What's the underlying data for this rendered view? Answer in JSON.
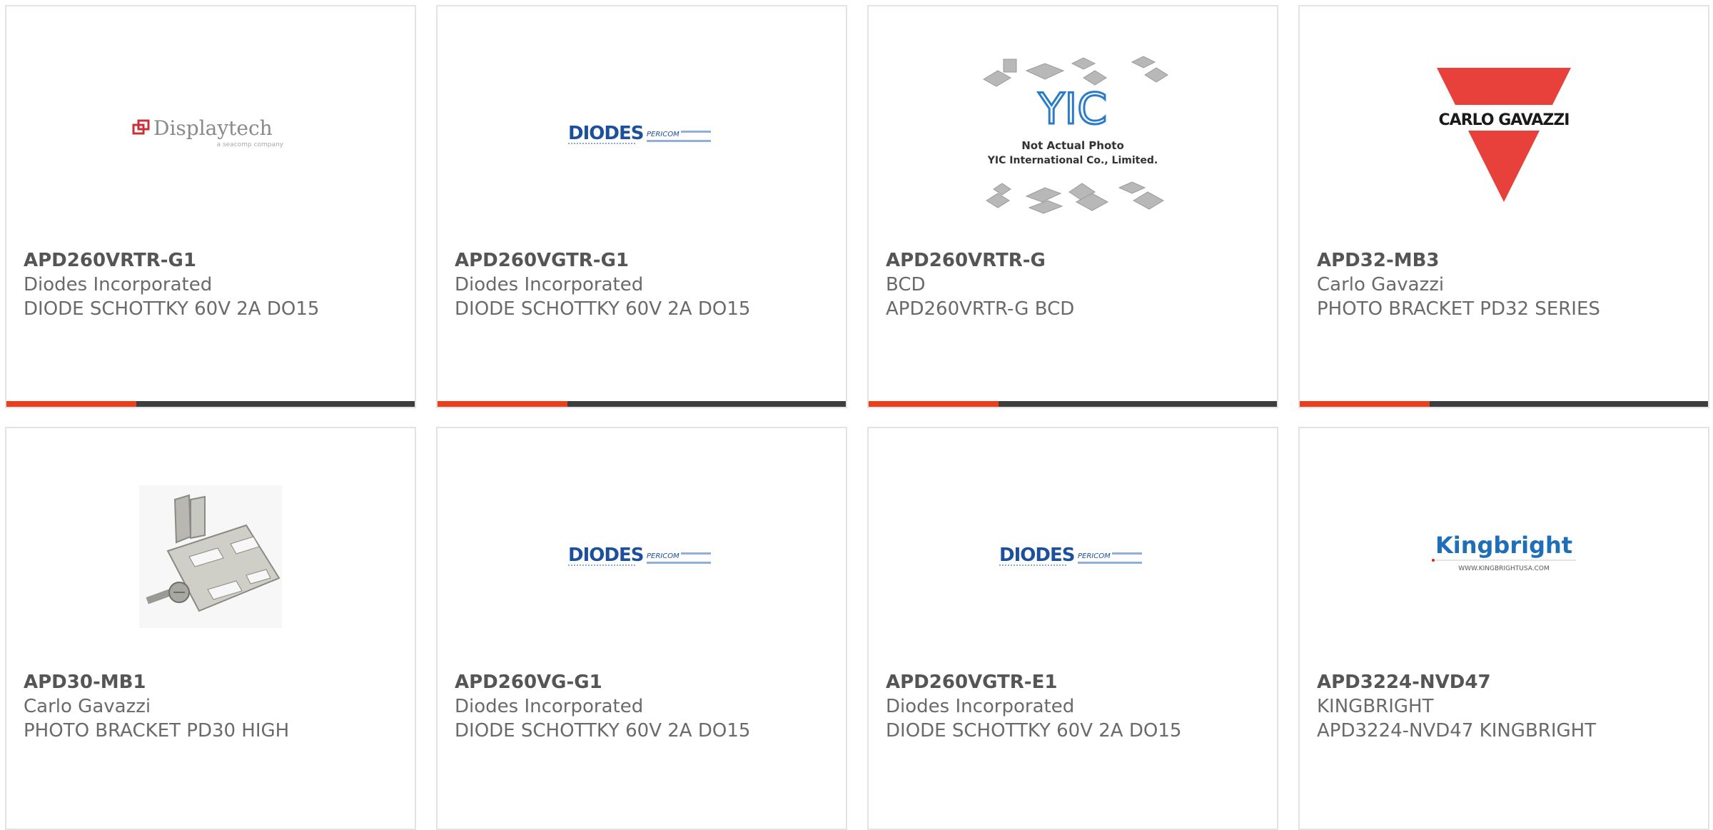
{
  "colors": {
    "accent": "#e8401c",
    "bar": "#3d3d3d",
    "text": "#6a6a6a",
    "border": "#e3e3e3"
  },
  "cards": [
    {
      "part": "APD260VRTR-G1",
      "manufacturer": "Diodes Incorporated",
      "description": "DIODE SCHOTTKY 60V 2A DO15",
      "image": "displaytech-logo",
      "logo_text": "Displaytech",
      "logo_sub": "a seacomp company"
    },
    {
      "part": "APD260VGTR-G1",
      "manufacturer": "Diodes Incorporated",
      "description": "DIODE SCHOTTKY 60V 2A DO15",
      "image": "diodes-pericom-logo",
      "logo_text": "DIODES",
      "logo_sub": "PERICOM"
    },
    {
      "part": "APD260VRTR-G",
      "manufacturer": "BCD",
      "description": "APD260VRTR-G BCD",
      "image": "yic-not-actual-photo",
      "logo_text": "Not Actual Photo",
      "logo_sub": "YIC International Co., Limited."
    },
    {
      "part": "APD32-MB3",
      "manufacturer": "Carlo Gavazzi",
      "description": "PHOTO BRACKET PD32 SERIES",
      "image": "carlo-gavazzi-logo",
      "logo_text": "CARLO GAVAZZI"
    },
    {
      "part": "APD30-MB1",
      "manufacturer": "Carlo Gavazzi",
      "description": "PHOTO BRACKET PD30 HIGH",
      "image": "bracket-photo"
    },
    {
      "part": "APD260VG-G1",
      "manufacturer": "Diodes Incorporated",
      "description": "DIODE SCHOTTKY 60V 2A DO15",
      "image": "diodes-pericom-logo",
      "logo_text": "DIODES",
      "logo_sub": "PERICOM"
    },
    {
      "part": "APD260VGTR-E1",
      "manufacturer": "Diodes Incorporated",
      "description": "DIODE SCHOTTKY 60V 2A DO15",
      "image": "diodes-pericom-logo",
      "logo_text": "DIODES",
      "logo_sub": "PERICOM"
    },
    {
      "part": "APD3224-NVD47",
      "manufacturer": "KINGBRIGHT",
      "description": "APD3224-NVD47 KINGBRIGHT",
      "image": "kingbright-logo",
      "logo_text": "Kingbright",
      "logo_sub": "WWW.KINGBRIGHTUSA.COM"
    }
  ]
}
